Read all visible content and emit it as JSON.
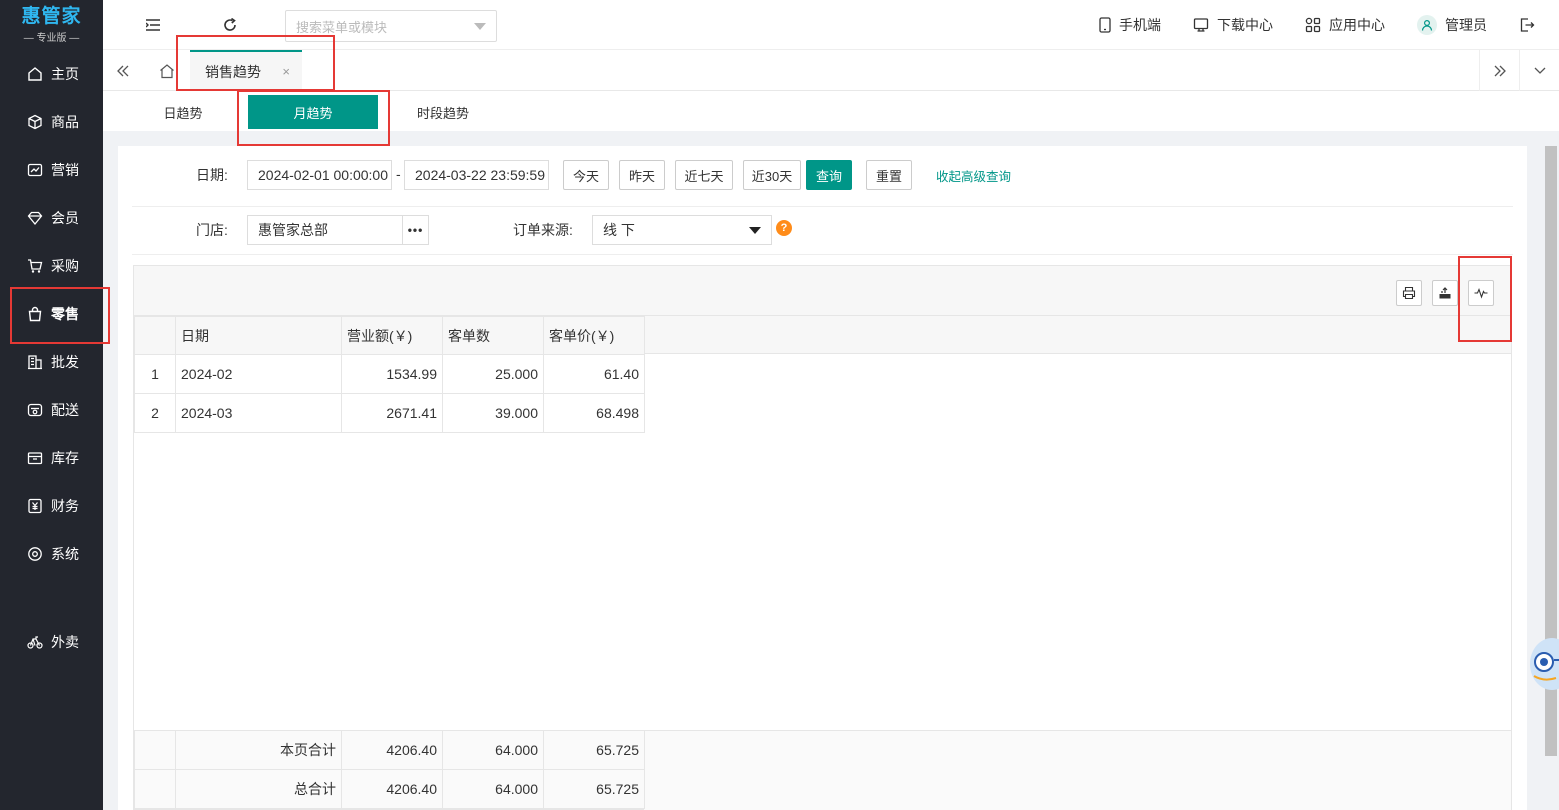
{
  "brand": {
    "logo": "惠管家",
    "edition": "— 专业版 —"
  },
  "sidebar": {
    "items": [
      {
        "label": "主页",
        "icon": "home-icon"
      },
      {
        "label": "商品",
        "icon": "box-icon"
      },
      {
        "label": "营销",
        "icon": "chart-icon"
      },
      {
        "label": "会员",
        "icon": "diamond-icon"
      },
      {
        "label": "采购",
        "icon": "cart-icon"
      },
      {
        "label": "零售",
        "icon": "bag-icon"
      },
      {
        "label": "批发",
        "icon": "building-icon"
      },
      {
        "label": "配送",
        "icon": "truck-icon"
      },
      {
        "label": "库存",
        "icon": "archive-icon"
      },
      {
        "label": "财务",
        "icon": "yen-icon"
      },
      {
        "label": "系统",
        "icon": "settings-icon"
      },
      {
        "label": "外卖",
        "icon": "bike-icon"
      }
    ]
  },
  "topbar": {
    "search_placeholder": "搜索菜单或模块",
    "mobile": "手机端",
    "download": "下载中心",
    "apps": "应用中心",
    "user": "管理员"
  },
  "tabs": {
    "active": "销售趋势",
    "close": "×"
  },
  "subtabs": [
    "日趋势",
    "月趋势",
    "时段趋势"
  ],
  "filters": {
    "date_label": "日期:",
    "date_from": "2024-02-01 00:00:00",
    "date_sep": "-",
    "date_to": "2024-03-22 23:59:59",
    "today": "今天",
    "yesterday": "昨天",
    "last7": "近七天",
    "last30": "近30天",
    "query": "查询",
    "reset": "重置",
    "collapse": "收起高级查询",
    "store_label": "门店:",
    "store_value": "惠管家总部",
    "store_more": "•••",
    "source_label": "订单来源:",
    "source_value": "线 下",
    "help": "?"
  },
  "table": {
    "headers": [
      "日期",
      "营业额(￥)",
      "客单数",
      "客单价(￥)"
    ],
    "rows": [
      {
        "idx": "1",
        "date": "2024-02",
        "revenue": "1534.99",
        "orders": "25.000",
        "avg": "61.40"
      },
      {
        "idx": "2",
        "date": "2024-03",
        "revenue": "2671.41",
        "orders": "39.000",
        "avg": "68.498"
      }
    ],
    "page_total": {
      "label": "本页合计",
      "revenue": "4206.40",
      "orders": "64.000",
      "avg": "65.725"
    },
    "grand_total": {
      "label": "总合计",
      "revenue": "4206.40",
      "orders": "64.000",
      "avg": "65.725"
    }
  },
  "colors": {
    "sidebar_bg": "#23262e",
    "accent": "#009688",
    "highlight": "#e53935",
    "brand": "#2fb7f0"
  }
}
